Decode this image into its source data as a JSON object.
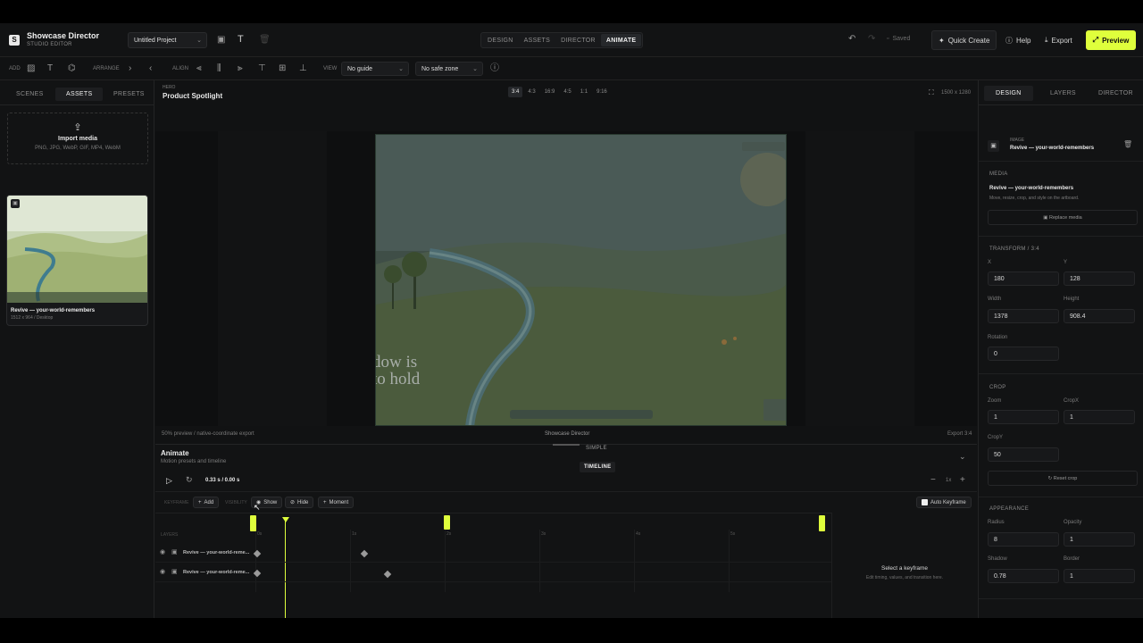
{
  "app": {
    "title": "Showcase Director",
    "subtitle": "STUDIO EDITOR"
  },
  "project": {
    "name": "Untitled Project"
  },
  "modes": [
    "DESIGN",
    "ASSETS",
    "DIRECTOR",
    "ANIMATE"
  ],
  "active_mode": "ANIMATE",
  "topbar": {
    "saved": "Saved",
    "quick_create": "Quick Create",
    "help": "Help",
    "export": "Export",
    "preview": "Preview"
  },
  "toolbar": {
    "add": "ADD",
    "arrange": "ARRANGE",
    "align": "ALIGN",
    "view": "VIEW",
    "guide": "No guide",
    "safe_zone": "No safe zone"
  },
  "left": {
    "tabs": [
      "SCENES",
      "ASSETS",
      "PRESETS"
    ],
    "active_tab": "ASSETS",
    "import_title": "Import media",
    "import_formats": "PNG, JPG, WebP, GIF, MP4, WebM",
    "asset": {
      "name": "Revive — your-world-remembers",
      "meta": "1512 x 964 / Desktop"
    }
  },
  "canvas": {
    "scene_label": "HERO",
    "scene_name": "Product Spotlight",
    "ratios": [
      "3:4",
      "4:3",
      "16:9",
      "4:5",
      "1:1",
      "9:16"
    ],
    "active_ratio": "3:4",
    "size": "1500 x 1280",
    "art_text_1": "dow is",
    "art_text_2": "to hold",
    "footer_left": "50% preview / native-coordinate export",
    "footer_center": "Showcase Director",
    "footer_right": "Export 3:4"
  },
  "animate": {
    "title": "Animate",
    "subtitle": "Motion presets and timeline",
    "view_simple": "SIMPLE",
    "view_timeline": "TIMELINE",
    "time": "0.33 s / 0.00 s",
    "zoom": "1x",
    "keyframes_label": "KEYFRAME",
    "visibility_label": "VISIBILITY",
    "add": "Add",
    "show": "Show",
    "hide": "Hide",
    "moment": "Moment",
    "auto_keyframe": "Auto Keyframe",
    "layers_label": "LAYERS",
    "ruler": [
      "0s",
      "1s",
      "2s",
      "3s",
      "4s",
      "5s"
    ],
    "layers": [
      "Revive — your-world-reme...",
      "Revive — your-world-reme..."
    ],
    "empty_title": "Select a keyframe",
    "empty_sub": "Edit timing, values, and transition here."
  },
  "right": {
    "tabs": [
      "DESIGN",
      "LAYERS",
      "DIRECTOR"
    ],
    "active_tab": "DESIGN",
    "selection_type": "IMAGE",
    "selection_name": "Revive — your-world-remembers",
    "media_section": "MEDIA",
    "media_name": "Revive — your-world-remembers",
    "media_hint": "Move, resize, crop, and style on the artboard.",
    "replace_media": "Replace media",
    "transform_section": "TRANSFORM / 3:4",
    "x_label": "X",
    "x": "180",
    "y_label": "Y",
    "y": "128",
    "width_label": "Width",
    "width": "1378",
    "height_label": "Height",
    "height": "908.4",
    "rotation_label": "Rotation",
    "rotation": "0",
    "crop_section": "CROP",
    "zoom_label": "Zoom",
    "zoom": "1",
    "cropx_label": "CropX",
    "cropx": "1",
    "cropy_label": "CropY",
    "cropy": "50",
    "reset_crop": "Reset crop",
    "appearance_section": "APPEARANCE",
    "radius_label": "Radius",
    "radius": "8",
    "opacity_label": "Opacity",
    "opacity": "1",
    "shadow_label": "Shadow",
    "shadow": "0.78",
    "border_label": "Border",
    "border": "1"
  },
  "colors": {
    "accent": "#dfff3c",
    "bg": "#111213",
    "panel": "#121314"
  }
}
